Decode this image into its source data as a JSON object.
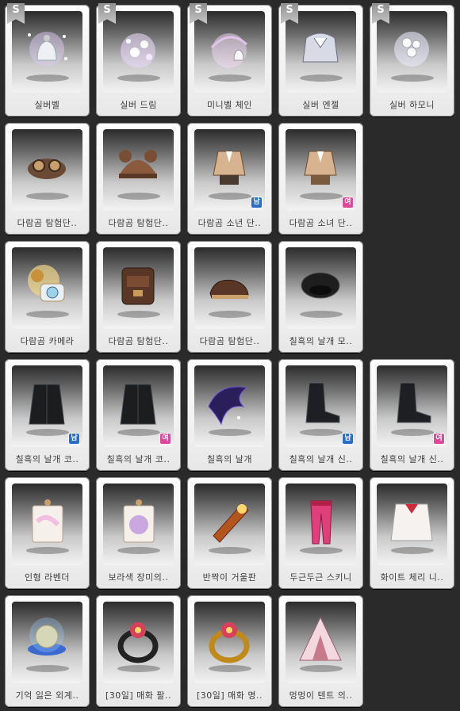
{
  "badge_label": "S",
  "gender_labels": {
    "m": "남",
    "f": "여"
  },
  "items": [
    {
      "name": "실버벨",
      "icon": "silver-bell-icon",
      "badge": true,
      "gender": null
    },
    {
      "name": "실버 드림",
      "icon": "silver-dream-icon",
      "badge": true,
      "gender": null
    },
    {
      "name": "미니벨 체인",
      "icon": "mini-bell-chain-icon",
      "badge": true,
      "gender": null
    },
    {
      "name": "실버 엔젤",
      "icon": "silver-angel-icon",
      "badge": true,
      "gender": null
    },
    {
      "name": "실버 하모니",
      "icon": "silver-harmony-icon",
      "badge": true,
      "gender": null
    },
    {
      "name": "다람곰 탐험단..",
      "icon": "goggles-cap-icon",
      "badge": false,
      "gender": null
    },
    {
      "name": "다람곰 탐험단..",
      "icon": "bear-hat-icon",
      "badge": false,
      "gender": null
    },
    {
      "name": "다람곰 소년 단..",
      "icon": "boy-uniform-icon",
      "badge": false,
      "gender": "m"
    },
    {
      "name": "다람곰 소녀 단..",
      "icon": "girl-uniform-icon",
      "badge": false,
      "gender": "f"
    },
    {
      "name": "다람곰 카메라",
      "icon": "camera-icon",
      "badge": false,
      "gender": null
    },
    {
      "name": "다람곰 탐험단..",
      "icon": "backpack-icon",
      "badge": false,
      "gender": null
    },
    {
      "name": "다람곰 탐험단..",
      "icon": "brown-shoes-icon",
      "badge": false,
      "gender": null
    },
    {
      "name": "칠흑의 날개 모..",
      "icon": "black-beret-icon",
      "badge": false,
      "gender": null
    },
    {
      "name": "칠흑의 날개 코..",
      "icon": "black-coat-icon",
      "badge": false,
      "gender": "m"
    },
    {
      "name": "칠흑의 날개 코..",
      "icon": "black-coat-icon",
      "badge": false,
      "gender": "f"
    },
    {
      "name": "칠흑의 날개",
      "icon": "dark-wings-icon",
      "badge": false,
      "gender": null
    },
    {
      "name": "칠흑의 날개 신..",
      "icon": "black-boots-icon",
      "badge": false,
      "gender": "m"
    },
    {
      "name": "칠흑의 날개 신..",
      "icon": "black-boots-icon",
      "badge": false,
      "gender": "f"
    },
    {
      "name": "인형 라벤더",
      "icon": "lavender-doll-pack-icon",
      "badge": false,
      "gender": null
    },
    {
      "name": "보라색 장미의..",
      "icon": "rose-tag-icon",
      "badge": false,
      "gender": null
    },
    {
      "name": "반짝이 거울판",
      "icon": "mirror-plate-icon",
      "badge": false,
      "gender": null
    },
    {
      "name": "두근두근 스키니",
      "icon": "pink-skinny-pants-icon",
      "badge": false,
      "gender": null
    },
    {
      "name": "화이트 체리 니..",
      "icon": "white-cherry-knit-icon",
      "badge": false,
      "gender": null
    },
    {
      "name": "기억 잃은 외계..",
      "icon": "alien-ufo-icon",
      "badge": false,
      "gender": null
    },
    {
      "name": "[30일] 매화 팔..",
      "icon": "plum-blossom-black-ring-icon",
      "badge": false,
      "gender": null
    },
    {
      "name": "[30일] 매화 명..",
      "icon": "plum-blossom-gold-ring-icon",
      "badge": false,
      "gender": null
    },
    {
      "name": "멍멍이 텐트 의..",
      "icon": "puppy-tent-icon",
      "badge": false,
      "gender": null
    }
  ]
}
